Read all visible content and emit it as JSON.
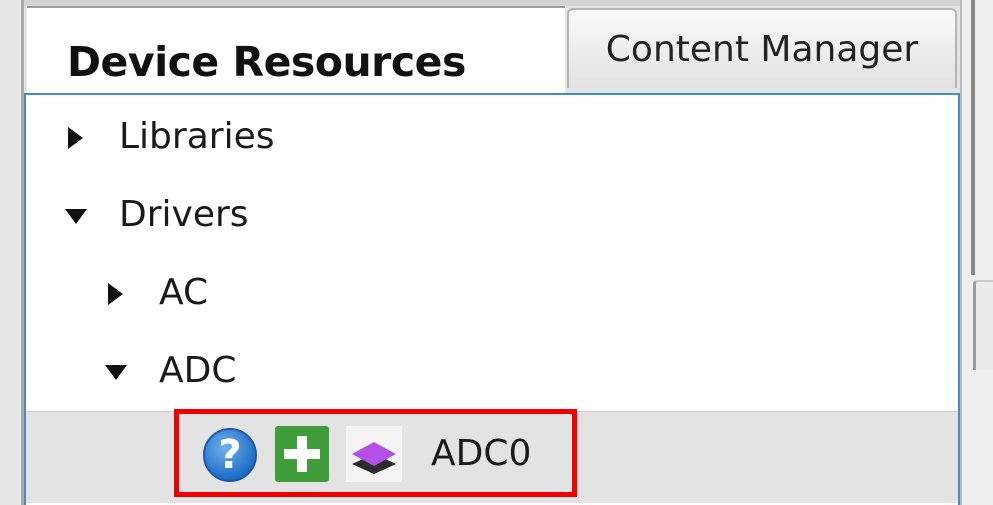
{
  "tabs": {
    "active_label": "Device Resources",
    "inactive_label": "Content Manager"
  },
  "tree": {
    "items": [
      {
        "label": "Libraries",
        "state": "collapsed"
      },
      {
        "label": "Drivers",
        "state": "expanded"
      },
      {
        "label": "AC",
        "state": "collapsed"
      },
      {
        "label": "ADC",
        "state": "expanded"
      }
    ],
    "selected_item": {
      "label": "ADC0",
      "icons": [
        "help-icon",
        "add-icon",
        "layers-icon"
      ]
    }
  },
  "colors": {
    "panel_border": "#3f8dd0",
    "highlight": "#ee0000",
    "selected_row": "#e3e3e3",
    "add_icon": "#3f9e3a",
    "help_icon": "#1f6fc6",
    "layers_icon": "#b24fe6"
  }
}
